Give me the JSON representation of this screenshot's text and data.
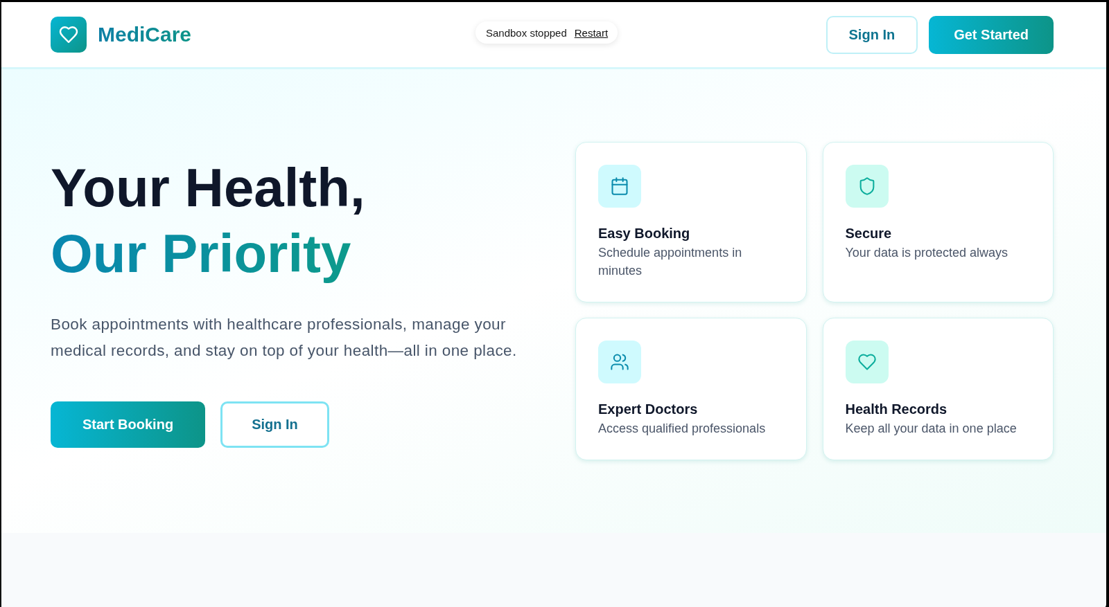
{
  "header": {
    "brand": "MediCare",
    "buttons": [
      {
        "label": "Sign In",
        "kind": "outline"
      },
      {
        "label": "Get Started",
        "kind": "primary"
      }
    ]
  },
  "sandbox_notice": {
    "status": "Sandbox stopped",
    "action": "Restart"
  },
  "hero": {
    "heading": "Your Health,",
    "heading_highlight": "Our Priority",
    "description": "Book appointments with healthcare professionals, manage your medical records, and stay on top of your health—all in one place.",
    "buttons": [
      {
        "label": "Start Booking",
        "kind": "primary"
      },
      {
        "label": "Sign In",
        "kind": "outline"
      }
    ]
  },
  "features": [
    {
      "title": "Easy Booking",
      "description": "Schedule appointments in minutes",
      "color": "#cffafe"
    },
    {
      "title": "Secure",
      "description": "Your data is protected always",
      "color": "#ccfbf1"
    },
    {
      "title": "Expert Doctors",
      "description": "Access qualified professionals",
      "color": "#cffafe"
    },
    {
      "title": "Health Records",
      "description": "Keep all your data in one place",
      "color": "#ccfbf1"
    }
  ]
}
